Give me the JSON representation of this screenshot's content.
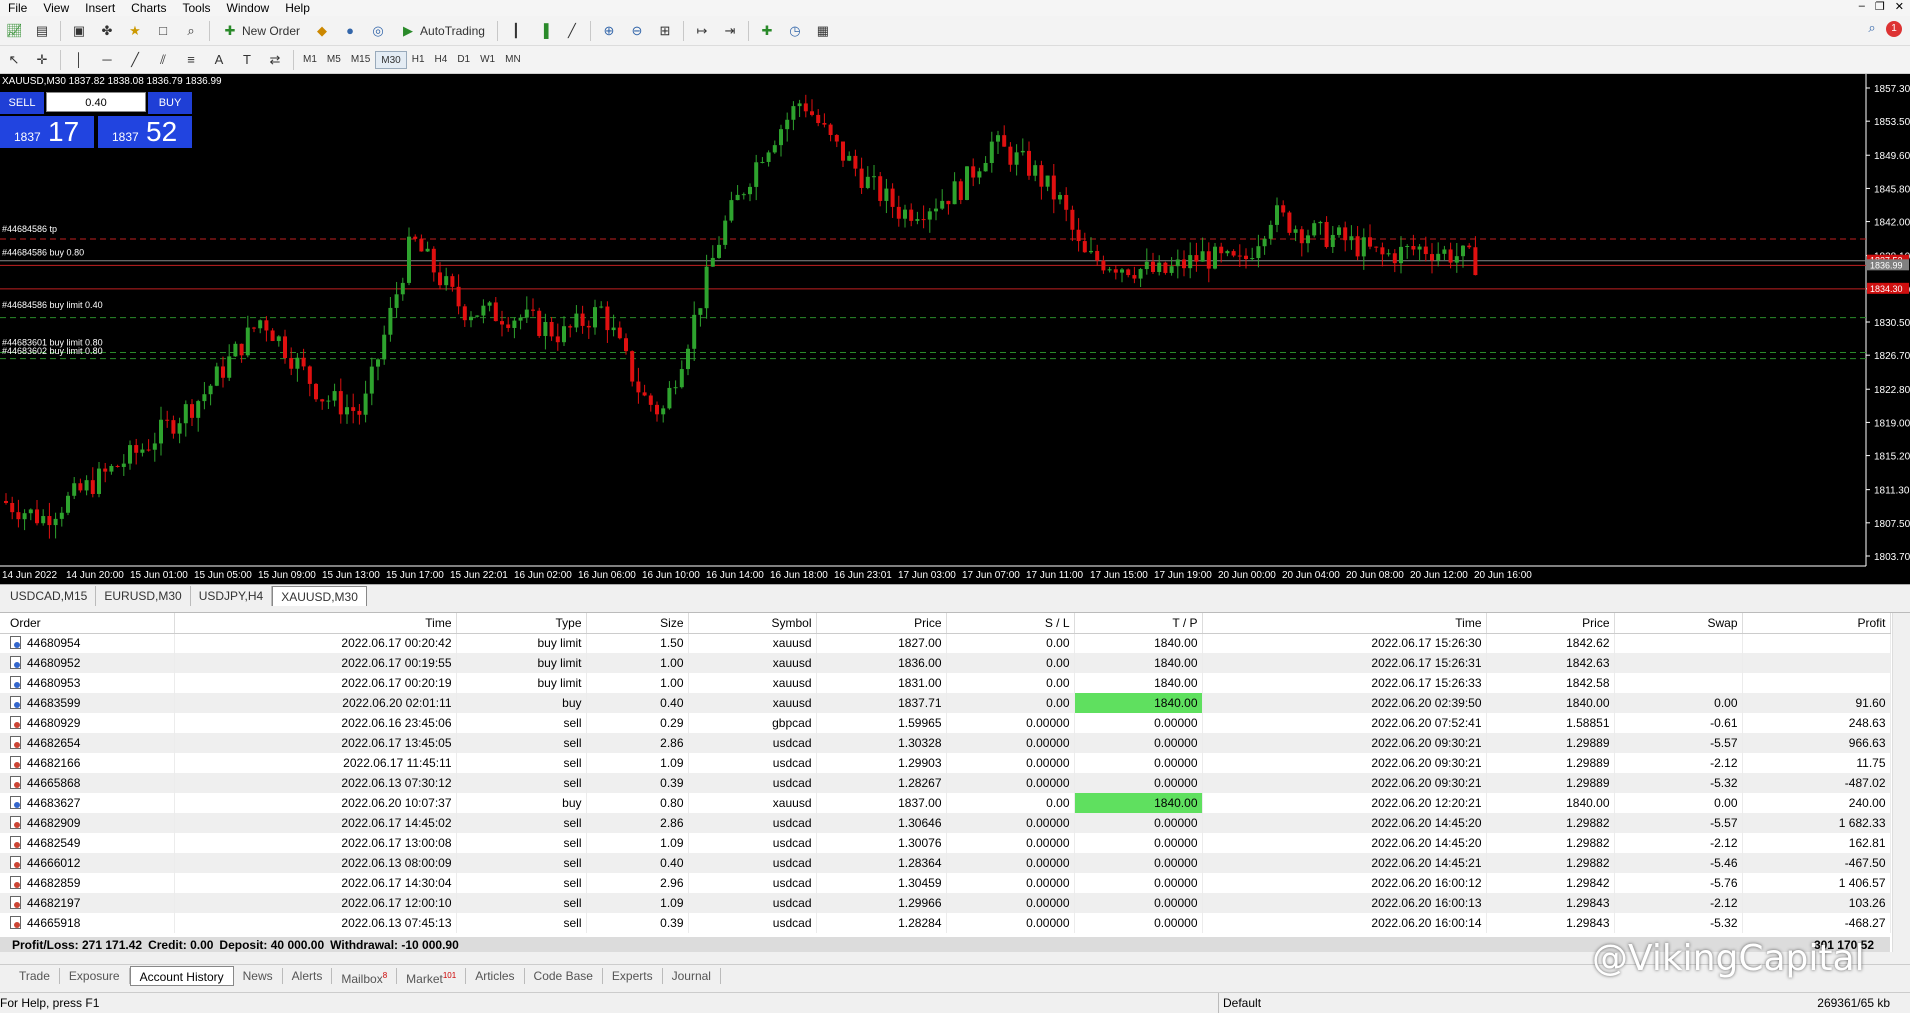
{
  "menu": [
    "File",
    "View",
    "Insert",
    "Charts",
    "Tools",
    "Window",
    "Help"
  ],
  "toolbar": {
    "new_order": "New Order",
    "autotrading": "AutoTrading"
  },
  "timeframes": [
    "M1",
    "M5",
    "M15",
    "M30",
    "H1",
    "H4",
    "D1",
    "W1",
    "MN"
  ],
  "active_timeframe": "M30",
  "chart": {
    "symbol_header": "XAUUSD,M30  1837.82 1838.08 1836.79 1836.99",
    "sell_label": "SELL",
    "buy_label": "BUY",
    "lot": "0.40",
    "bid_small": "1837",
    "bid_big": "17",
    "ask_small": "1837",
    "ask_big": "52",
    "price_axis": [
      "1857.30",
      "1853.50",
      "1849.60",
      "1845.80",
      "1842.00",
      "1838.10",
      "1834.30",
      "1830.50",
      "1826.70",
      "1822.80",
      "1819.00",
      "1815.20",
      "1811.30",
      "1807.50",
      "1803.70"
    ],
    "price_tags": [
      "1837.52",
      "1836.99",
      "1834.30"
    ],
    "time_axis": [
      "14 Jun 2022",
      "14 Jun 20:00",
      "15 Jun 01:00",
      "15 Jun 05:00",
      "15 Jun 09:00",
      "15 Jun 13:00",
      "15 Jun 17:00",
      "15 Jun 22:01",
      "16 Jun 02:00",
      "16 Jun 06:00",
      "16 Jun 10:00",
      "16 Jun 14:00",
      "16 Jun 18:00",
      "16 Jun 23:01",
      "17 Jun 03:00",
      "17 Jun 07:00",
      "17 Jun 11:00",
      "17 Jun 15:00",
      "17 Jun 19:00",
      "20 Jun 00:00",
      "20 Jun 04:00",
      "20 Jun 08:00",
      "20 Jun 12:00",
      "20 Jun 16:00"
    ],
    "order_labels": [
      "#44684586 tp",
      "#44684586 buy 0.80",
      "#44684586 buy limit 0.40",
      "#44683601 buy limit 0.80",
      "#44683602 buy limit 0.80"
    ]
  },
  "chart_tabs": [
    "USDCAD,M15",
    "EURUSD,M30",
    "USDJPY,H4",
    "XAUUSD,M30"
  ],
  "active_chart_tab": "XAUUSD,M30",
  "columns": [
    "Order",
    "Time",
    "Type",
    "Size",
    "Symbol",
    "Price",
    "S / L",
    "T / P",
    "Time",
    "Price",
    "Swap",
    "Profit"
  ],
  "rows": [
    {
      "order": "44680954",
      "open_time": "2022.06.17 00:20:42",
      "type": "buy limit",
      "size": "1.50",
      "symbol": "xauusd",
      "price": "1827.00",
      "sl": "0.00",
      "tp": "1840.00",
      "close_time": "2022.06.17 15:26:30",
      "close_price": "1842.62",
      "swap": "",
      "profit": "",
      "tp_hit": false
    },
    {
      "order": "44680952",
      "open_time": "2022.06.17 00:19:55",
      "type": "buy limit",
      "size": "1.00",
      "symbol": "xauusd",
      "price": "1836.00",
      "sl": "0.00",
      "tp": "1840.00",
      "close_time": "2022.06.17 15:26:31",
      "close_price": "1842.63",
      "swap": "",
      "profit": "",
      "tp_hit": false
    },
    {
      "order": "44680953",
      "open_time": "2022.06.17 00:20:19",
      "type": "buy limit",
      "size": "1.00",
      "symbol": "xauusd",
      "price": "1831.00",
      "sl": "0.00",
      "tp": "1840.00",
      "close_time": "2022.06.17 15:26:33",
      "close_price": "1842.58",
      "swap": "",
      "profit": "",
      "tp_hit": false
    },
    {
      "order": "44683599",
      "open_time": "2022.06.20 02:01:11",
      "type": "buy",
      "size": "0.40",
      "symbol": "xauusd",
      "price": "1837.71",
      "sl": "0.00",
      "tp": "1840.00",
      "close_time": "2022.06.20 02:39:50",
      "close_price": "1840.00",
      "swap": "0.00",
      "profit": "91.60",
      "tp_hit": true
    },
    {
      "order": "44680929",
      "open_time": "2022.06.16 23:45:06",
      "type": "sell",
      "size": "0.29",
      "symbol": "gbpcad",
      "price": "1.59965",
      "sl": "0.00000",
      "tp": "0.00000",
      "close_time": "2022.06.20 07:52:41",
      "close_price": "1.58851",
      "swap": "-0.61",
      "profit": "248.63",
      "tp_hit": false
    },
    {
      "order": "44682654",
      "open_time": "2022.06.17 13:45:05",
      "type": "sell",
      "size": "2.86",
      "symbol": "usdcad",
      "price": "1.30328",
      "sl": "0.00000",
      "tp": "0.00000",
      "close_time": "2022.06.20 09:30:21",
      "close_price": "1.29889",
      "swap": "-5.57",
      "profit": "966.63",
      "tp_hit": false
    },
    {
      "order": "44682166",
      "open_time": "2022.06.17 11:45:11",
      "type": "sell",
      "size": "1.09",
      "symbol": "usdcad",
      "price": "1.29903",
      "sl": "0.00000",
      "tp": "0.00000",
      "close_time": "2022.06.20 09:30:21",
      "close_price": "1.29889",
      "swap": "-2.12",
      "profit": "11.75",
      "tp_hit": false
    },
    {
      "order": "44665868",
      "open_time": "2022.06.13 07:30:12",
      "type": "sell",
      "size": "0.39",
      "symbol": "usdcad",
      "price": "1.28267",
      "sl": "0.00000",
      "tp": "0.00000",
      "close_time": "2022.06.20 09:30:21",
      "close_price": "1.29889",
      "swap": "-5.32",
      "profit": "-487.02",
      "tp_hit": false
    },
    {
      "order": "44683627",
      "open_time": "2022.06.20 10:07:37",
      "type": "buy",
      "size": "0.80",
      "symbol": "xauusd",
      "price": "1837.00",
      "sl": "0.00",
      "tp": "1840.00",
      "close_time": "2022.06.20 12:20:21",
      "close_price": "1840.00",
      "swap": "0.00",
      "profit": "240.00",
      "tp_hit": true
    },
    {
      "order": "44682909",
      "open_time": "2022.06.17 14:45:02",
      "type": "sell",
      "size": "2.86",
      "symbol": "usdcad",
      "price": "1.30646",
      "sl": "0.00000",
      "tp": "0.00000",
      "close_time": "2022.06.20 14:45:20",
      "close_price": "1.29882",
      "swap": "-5.57",
      "profit": "1 682.33",
      "tp_hit": false
    },
    {
      "order": "44682549",
      "open_time": "2022.06.17 13:00:08",
      "type": "sell",
      "size": "1.09",
      "symbol": "usdcad",
      "price": "1.30076",
      "sl": "0.00000",
      "tp": "0.00000",
      "close_time": "2022.06.20 14:45:20",
      "close_price": "1.29882",
      "swap": "-2.12",
      "profit": "162.81",
      "tp_hit": false
    },
    {
      "order": "44666012",
      "open_time": "2022.06.13 08:00:09",
      "type": "sell",
      "size": "0.40",
      "symbol": "usdcad",
      "price": "1.28364",
      "sl": "0.00000",
      "tp": "0.00000",
      "close_time": "2022.06.20 14:45:21",
      "close_price": "1.29882",
      "swap": "-5.46",
      "profit": "-467.50",
      "tp_hit": false
    },
    {
      "order": "44682859",
      "open_time": "2022.06.17 14:30:04",
      "type": "sell",
      "size": "2.96",
      "symbol": "usdcad",
      "price": "1.30459",
      "sl": "0.00000",
      "tp": "0.00000",
      "close_time": "2022.06.20 16:00:12",
      "close_price": "1.29842",
      "swap": "-5.76",
      "profit": "1 406.57",
      "tp_hit": false
    },
    {
      "order": "44682197",
      "open_time": "2022.06.17 12:00:10",
      "type": "sell",
      "size": "1.09",
      "symbol": "usdcad",
      "price": "1.29966",
      "sl": "0.00000",
      "tp": "0.00000",
      "close_time": "2022.06.20 16:00:13",
      "close_price": "1.29843",
      "swap": "-2.12",
      "profit": "103.26",
      "tp_hit": false
    },
    {
      "order": "44665918",
      "open_time": "2022.06.13 07:45:13",
      "type": "sell",
      "size": "0.39",
      "symbol": "usdcad",
      "price": "1.28284",
      "sl": "0.00000",
      "tp": "0.00000",
      "close_time": "2022.06.20 16:00:14",
      "close_price": "1.29843",
      "swap": "-5.32",
      "profit": "-468.27",
      "tp_hit": false
    }
  ],
  "summary": {
    "profit_loss": "Profit/Loss: 271 171.42",
    "credit": "Credit: 0.00",
    "deposit": "Deposit: 40 000.00",
    "withdrawal": "Withdrawal: -10 000.90",
    "total": "301 170.52"
  },
  "bottom_tabs": [
    "Trade",
    "Exposure",
    "Account History",
    "News",
    "Alerts",
    "Mailbox",
    "Market",
    "Articles",
    "Code Base",
    "Experts",
    "Journal"
  ],
  "bottom_tab_badges": {
    "Mailbox": "8",
    "Market": "101"
  },
  "active_bottom_tab": "Account History",
  "status": {
    "help": "For Help, press F1",
    "profile": "Default",
    "traffic": "269361/65 kb"
  },
  "watermark": "@VikingCapital",
  "colors": {
    "chart_bg": "#000000",
    "bull": "#2ea32e",
    "bear": "#e01010",
    "tp_cell": "#5fe05f",
    "one_click": "#1f3fd6"
  }
}
